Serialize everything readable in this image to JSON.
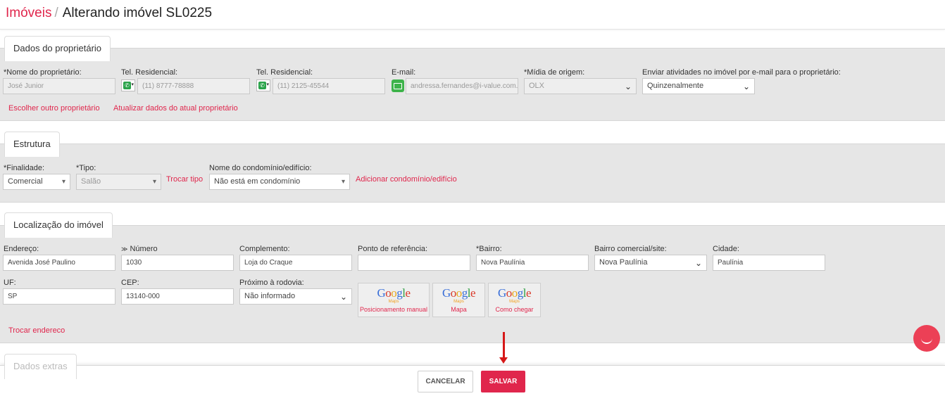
{
  "breadcrumb": {
    "root": "Imóveis",
    "separator": "/",
    "title": "Alterando imóvel SL0225"
  },
  "owner": {
    "tab": "Dados do proprietário",
    "name": {
      "label": "*Nome do proprietário:",
      "value": "José Junior"
    },
    "phone1": {
      "label": "Tel. Residencial:",
      "value": "(11) 8777-78888"
    },
    "phone2": {
      "label": "Tel. Residencial:",
      "value": "(11) 2125-45544"
    },
    "email": {
      "label": "E-mail:",
      "value": "andressa.fernandes@i-value.com."
    },
    "media": {
      "label": "*Mídia de origem:",
      "value": "OLX"
    },
    "send": {
      "label": "Enviar atividades no imóvel por e-mail para o proprietário:",
      "value": "Quinzenalmente"
    },
    "link_choose": "Escolher outro proprietário",
    "link_update": "Atualizar dados do atual proprietário"
  },
  "structure": {
    "tab": "Estrutura",
    "purpose": {
      "label": "*Finalidade:",
      "value": "Comercial"
    },
    "type": {
      "label": "*Tipo:",
      "value": "Salão"
    },
    "link_type": "Trocar tipo",
    "condo": {
      "label": "Nome do condomínio/edifício:",
      "value": "Não está em condomínio"
    },
    "link_condo": "Adicionar condomínio/edifício"
  },
  "location": {
    "tab": "Localização do imóvel",
    "address": {
      "label": "Endereço:",
      "value": "Avenida José Paulino"
    },
    "number": {
      "label": "Número",
      "value": "1030"
    },
    "complement": {
      "label": "Complemento:",
      "value": "Loja do Craque"
    },
    "reference": {
      "label": "Ponto de referência:",
      "value": ""
    },
    "district": {
      "label": "*Bairro:",
      "value": "Nova Paulínia"
    },
    "commercial_district": {
      "label": "Bairro comercial/site:",
      "value": "Nova Paulínia"
    },
    "city": {
      "label": "Cidade:",
      "value": "Paulínia"
    },
    "uf": {
      "label": "UF:",
      "value": "SP"
    },
    "cep": {
      "label": "CEP:",
      "value": "13140-000"
    },
    "highway": {
      "label": "Próximo à rodovia:",
      "value": "Não informado"
    },
    "maps_buttons": [
      {
        "logo": "Google",
        "sub": "Maps",
        "caption": "Posicionamento manual"
      },
      {
        "logo": "Google",
        "sub": "Maps",
        "caption": "Mapa"
      },
      {
        "logo": "Google",
        "sub": "Maps",
        "caption": "Como chegar"
      }
    ],
    "link_change": "Trocar endereco"
  },
  "next_section_tab": "Dados extras",
  "footer": {
    "cancel": "CANCELAR",
    "save": "SALVAR"
  }
}
